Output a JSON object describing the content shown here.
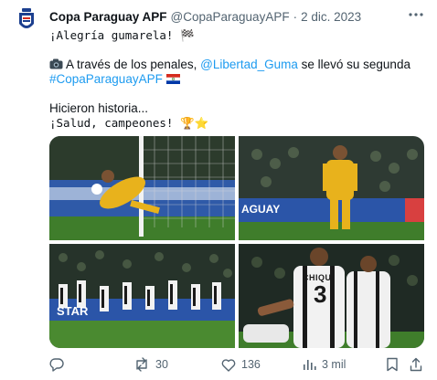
{
  "post": {
    "author_name": "Copa Paraguay APF",
    "handle": "@CopaParaguayAPF",
    "separator": "·",
    "date": "2 dic. 2023"
  },
  "body": {
    "line1": "¡Alegría gumarela! 🏁",
    "line2_pre": "A través de los penales, ",
    "line2_mention": "@Libertad_Guma",
    "line2_post": " se llevó su segunda",
    "hashtag": "#CopaParaguayAPF",
    "line4": "Hicieron historia...",
    "line5": "¡Salud, campeones! 🏆⭐"
  },
  "photos": {
    "p1": {
      "banner_text": ""
    },
    "p2": {
      "banner_text": "AGUAY"
    },
    "p3": {
      "banner_text": "STAR"
    },
    "p4": {
      "jersey_text": "CHIQUI",
      "jersey_number": "3"
    }
  },
  "actions": {
    "replies": "",
    "reposts": "30",
    "likes": "136",
    "views": "3 mil"
  },
  "colors": {
    "link": "#1d9bf0",
    "muted": "#536471",
    "pitch": "#3f7d2b",
    "keeper_yellow": "#e8b21c"
  }
}
